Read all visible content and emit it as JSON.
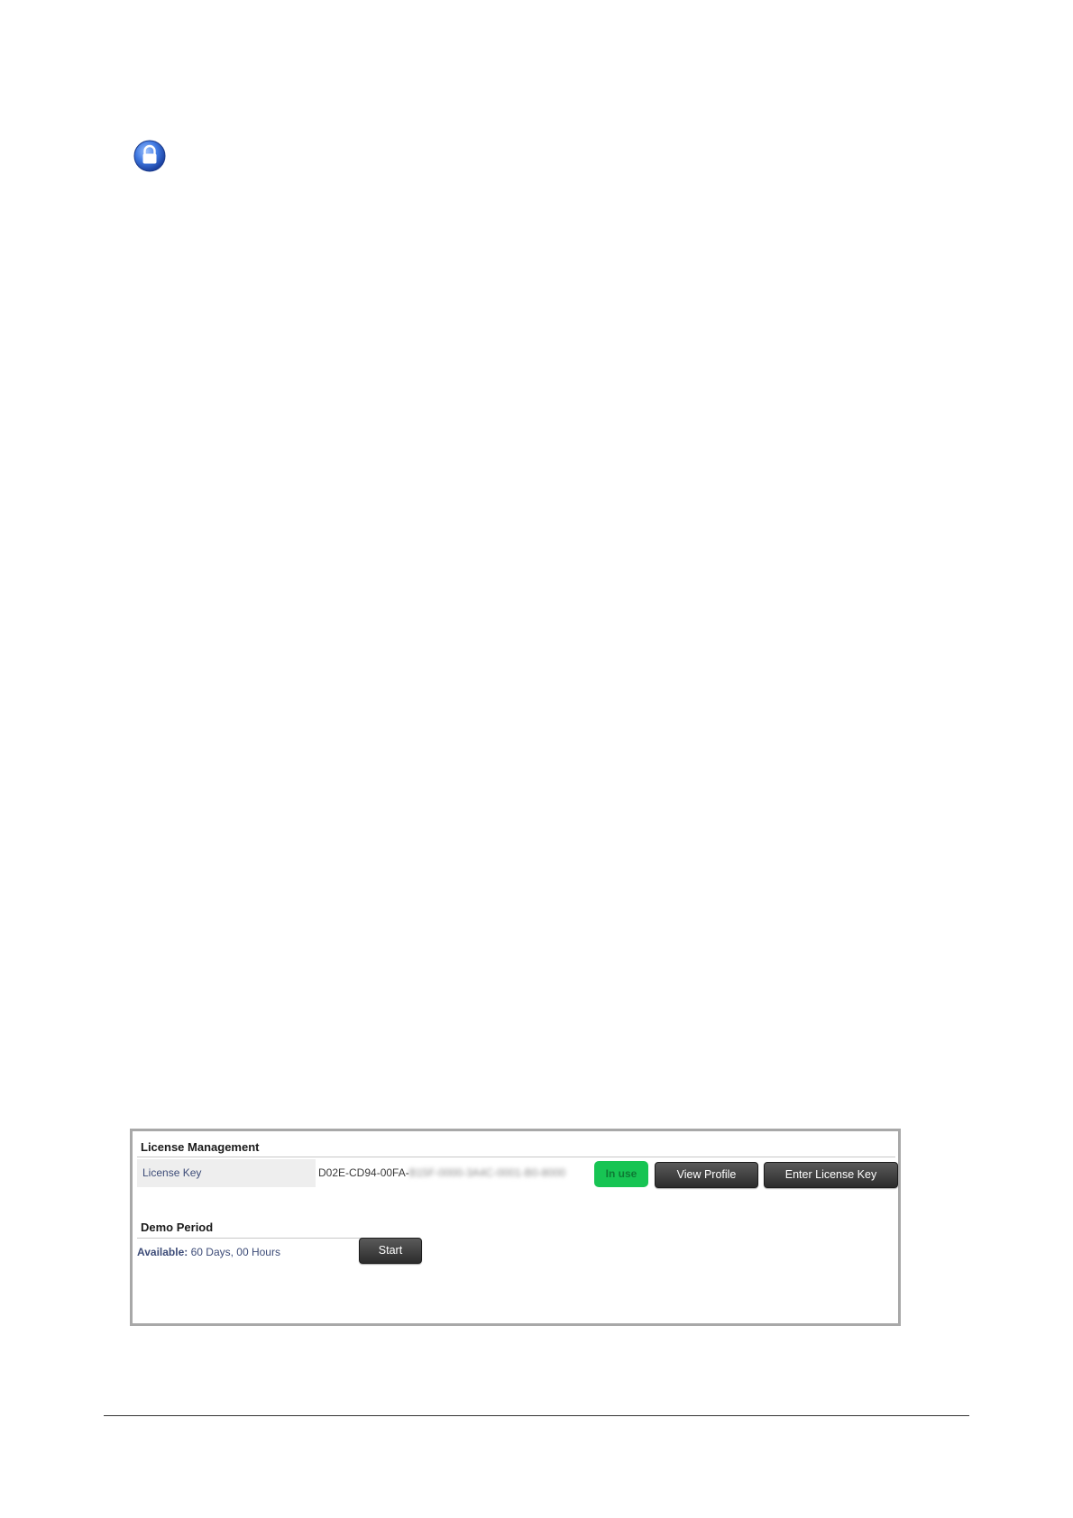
{
  "license_management": {
    "title": "License Management",
    "license_key_label": "License Key",
    "license_key_visible": "D02E-CD94-00FA-",
    "license_key_obscured": "B15F-0000-3A4C-0001-B0-8000",
    "status_badge": "In use",
    "status_color": "#17c453",
    "view_profile_label": "View Profile",
    "enter_license_key_label": "Enter License Key"
  },
  "demo_period": {
    "title": "Demo Period",
    "available_label": "Available:",
    "available_value": "60 Days, 00 Hours",
    "start_label": "Start"
  },
  "icons": {
    "top_icon": "lock-icon"
  }
}
